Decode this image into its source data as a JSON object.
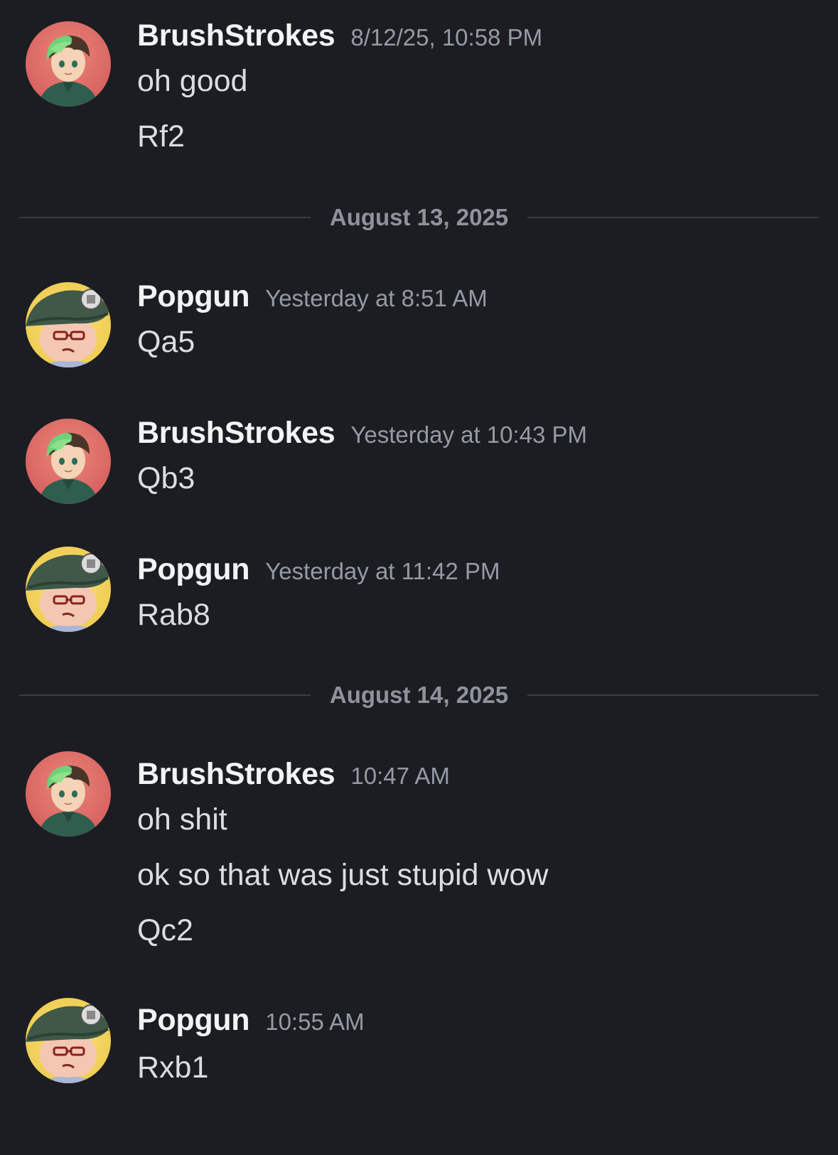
{
  "users": {
    "brush": {
      "name": "BrushStrokes",
      "avatar_icon": "green-hair-avatar-icon",
      "avatar_bg": "#e06a62"
    },
    "pop": {
      "name": "Popgun",
      "avatar_icon": "beret-avatar-icon",
      "avatar_bg": "#f3d35a"
    }
  },
  "messages": [
    {
      "author": "BrushStrokes",
      "timestamp": "8/12/25, 10:58 PM",
      "lines": [
        "oh good",
        "Rf2"
      ]
    },
    {
      "author": "Popgun",
      "timestamp": "Yesterday at 8:51 AM",
      "lines": [
        "Qa5"
      ]
    },
    {
      "author": "BrushStrokes",
      "timestamp": "Yesterday at 10:43 PM",
      "lines": [
        "Qb3"
      ]
    },
    {
      "author": "Popgun",
      "timestamp": "Yesterday at 11:42 PM",
      "lines": [
        "Rab8"
      ]
    },
    {
      "author": "BrushStrokes",
      "timestamp": "10:47 AM",
      "lines": [
        "oh shit",
        "ok so that was just stupid wow",
        "Qc2"
      ]
    },
    {
      "author": "Popgun",
      "timestamp": "10:55 AM",
      "lines": [
        "Rxb1"
      ]
    }
  ],
  "dividers": [
    {
      "date": "August 13, 2025"
    },
    {
      "date": "August 14, 2025"
    }
  ],
  "colors": {
    "background": "#1c1d22",
    "username": "#f2f3f5",
    "timestamp": "#949ba4",
    "message_text": "#dbdee1",
    "divider_text": "#8e939b",
    "divider_rule": "#3a3c43"
  }
}
